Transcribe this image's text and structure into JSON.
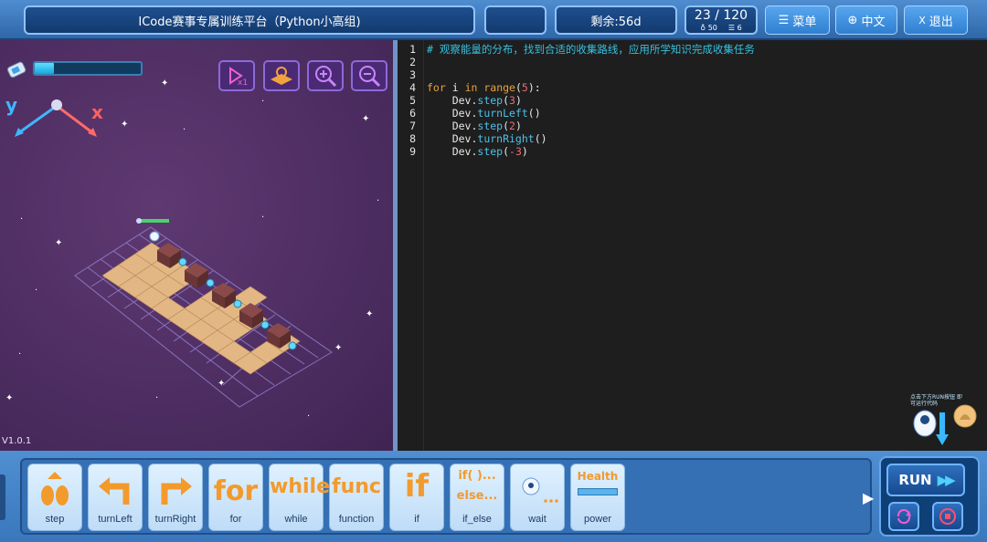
{
  "header": {
    "title": "ICode赛事专属训练平台（Python小高组)",
    "blank_box": "",
    "remaining": "剩余:56d",
    "level": "23 / 120",
    "level_stat_a": "♁ 50",
    "level_stat_b": "☰ 6",
    "menu_label": "菜单",
    "lang_label": "中文",
    "exit_label": "退出"
  },
  "game": {
    "energy_level": 0.18,
    "axis_y": "y",
    "axis_x": "x",
    "version": "V1.0.1"
  },
  "editor": {
    "lines": [
      {
        "n": "1",
        "text": "# 观察能量的分布，找到合适的收集路线，应用所学知识完成收集任务"
      },
      {
        "n": "2",
        "text": ""
      },
      {
        "n": "3",
        "text": ""
      },
      {
        "n": "4",
        "text": "for i in range(5):"
      },
      {
        "n": "5",
        "text": "    Dev.step(3)"
      },
      {
        "n": "6",
        "text": "    Dev.turnLeft()"
      },
      {
        "n": "7",
        "text": "    Dev.step(2)"
      },
      {
        "n": "8",
        "text": "    Dev.turnRight()"
      },
      {
        "n": "9",
        "text": "    Dev.step(-3)"
      }
    ],
    "hint": "点击下方RUN按钮 即可运行代码"
  },
  "palette": {
    "blocks": [
      {
        "glyph": "",
        "label": "step"
      },
      {
        "glyph": "",
        "label": "turnLeft"
      },
      {
        "glyph": "",
        "label": "turnRight"
      },
      {
        "glyph": "for",
        "label": "for"
      },
      {
        "glyph": "while",
        "label": "while"
      },
      {
        "glyph": "func",
        "label": "function"
      },
      {
        "glyph": "if",
        "label": "if"
      },
      {
        "glyph": "if( )...else...",
        "label": "if_else"
      },
      {
        "glyph": "",
        "label": "wait"
      },
      {
        "glyph": "Health",
        "label": "power"
      }
    ]
  },
  "run": {
    "label": "RUN"
  },
  "colors": {
    "accent": "#2f7fd1",
    "code_bg": "#1e1e1e",
    "game_bg": "#4a2b5e",
    "block_orange": "#f39a2c"
  }
}
